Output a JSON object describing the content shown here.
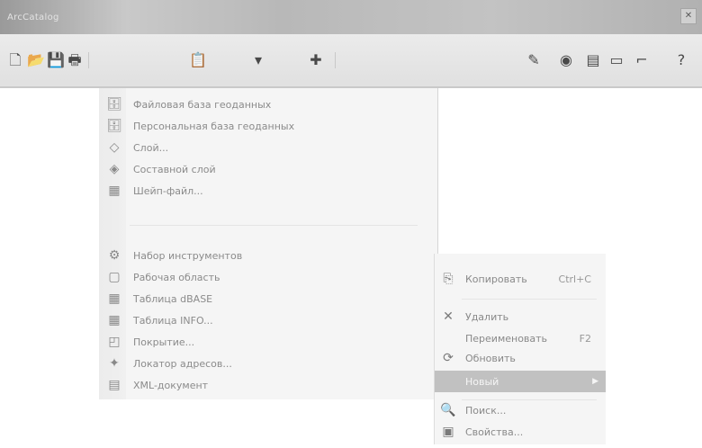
{
  "window": {
    "title": "ArcCatalog",
    "close_glyph": "✕"
  },
  "toolbar": {
    "icons": [
      {
        "name": "new-document-icon",
        "glyph": "🗋"
      },
      {
        "name": "open-folder-icon",
        "glyph": "📂"
      },
      {
        "name": "save-icon",
        "glyph": "💾"
      },
      {
        "name": "print-icon",
        "glyph": "🖶"
      },
      {
        "name": "clipboard-icon",
        "glyph": "📋"
      },
      {
        "name": "dropdown-icon",
        "glyph": "▾"
      },
      {
        "name": "add-data-icon",
        "glyph": "✚"
      },
      {
        "name": "edit-pencil-icon",
        "glyph": "✎"
      },
      {
        "name": "globe-icon",
        "glyph": "◉"
      },
      {
        "name": "layers-icon",
        "glyph": "▤"
      },
      {
        "name": "window-icon",
        "glyph": "▭"
      },
      {
        "name": "cursor-icon",
        "glyph": "⌐"
      },
      {
        "name": "help-icon",
        "glyph": "?"
      }
    ]
  },
  "left_menu": {
    "items": [
      {
        "name": "file-geodatabase",
        "icon": "🗄",
        "label": "Файловая база геоданных"
      },
      {
        "name": "personal-geodatabase",
        "icon": "🗄",
        "label": "Персональная база геоданных"
      },
      {
        "name": "layer",
        "icon": "◇",
        "label": "Слой..."
      },
      {
        "name": "group-layer",
        "icon": "◈",
        "label": "Составной слой"
      },
      {
        "name": "shapefile",
        "icon": "▦",
        "label": "Шейп-файл..."
      },
      {
        "name": "toolbox",
        "icon": "⚙",
        "label": "Набор инструментов"
      },
      {
        "name": "workspace",
        "icon": "▢",
        "label": "Рабочая область"
      },
      {
        "name": "dbase-table",
        "icon": "▦",
        "label": "Таблица dBASE"
      },
      {
        "name": "info-table",
        "icon": "▦",
        "label": "Таблица INFO..."
      },
      {
        "name": "coverage",
        "icon": "◰",
        "label": "Покрытие..."
      },
      {
        "name": "address-locator",
        "icon": "✦",
        "label": "Локатор адресов..."
      },
      {
        "name": "xml-document",
        "icon": "▤",
        "label": "XML-документ"
      }
    ]
  },
  "context_menu": {
    "items": [
      {
        "name": "copy",
        "icon": "⎘",
        "label": "Копировать",
        "shortcut": "Ctrl+C"
      },
      {
        "name": "delete",
        "icon": "✕",
        "label": "Удалить",
        "shortcut": ""
      },
      {
        "name": "rename",
        "icon": "",
        "label": "Переименовать",
        "shortcut": "F2"
      },
      {
        "name": "refresh",
        "icon": "⟳",
        "label": "Обновить",
        "shortcut": ""
      },
      {
        "name": "new",
        "icon": "",
        "label": "Новый",
        "shortcut": "",
        "selected": true,
        "arrow": "▶"
      },
      {
        "name": "search",
        "icon": "🔍",
        "label": "Поиск...",
        "shortcut": ""
      },
      {
        "name": "properties",
        "icon": "▣",
        "label": "Свойства...",
        "shortcut": ""
      }
    ]
  }
}
